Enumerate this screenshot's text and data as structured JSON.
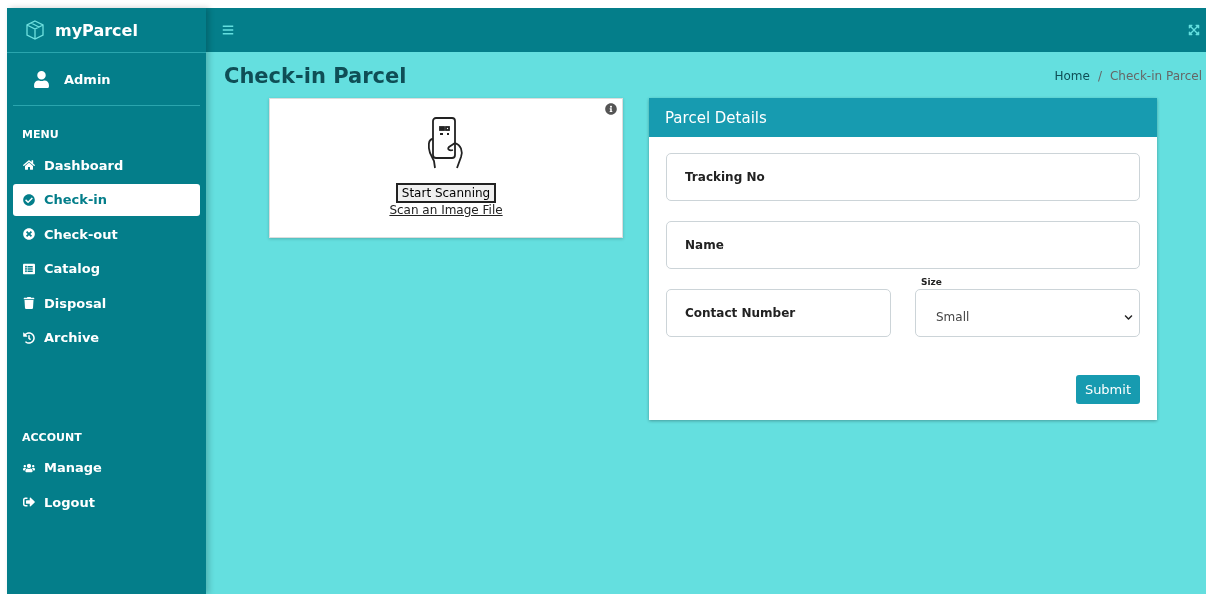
{
  "brand": "myParcel",
  "user": {
    "name": "Admin"
  },
  "menu_sections": [
    {
      "title": "MENU",
      "items": [
        {
          "label": "Dashboard",
          "selected": false
        },
        {
          "label": "Check-in",
          "selected": true
        },
        {
          "label": "Check-out",
          "selected": false
        },
        {
          "label": "Catalog",
          "selected": false
        },
        {
          "label": "Disposal",
          "selected": false
        },
        {
          "label": "Archive",
          "selected": false
        }
      ]
    },
    {
      "title": "ACCOUNT",
      "items": [
        {
          "label": "Manage",
          "selected": false
        },
        {
          "label": "Logout",
          "selected": false
        }
      ]
    }
  ],
  "page_title": "Check-in Parcel",
  "breadcrumb": [
    "Home",
    "Check-in Parcel"
  ],
  "breadcrumb_separator": "/",
  "scanner": {
    "button": "Start Scanning",
    "link": "Scan an Image File"
  },
  "form": {
    "title": "Parcel Details",
    "fields": [
      {
        "kind": "input",
        "label": "Tracking No"
      },
      {
        "kind": "input",
        "label": "Name"
      },
      {
        "kind": "input",
        "label": "Contact Number"
      },
      {
        "kind": "select",
        "label": "Size",
        "value": "Small"
      }
    ],
    "submit": "Submit"
  }
}
